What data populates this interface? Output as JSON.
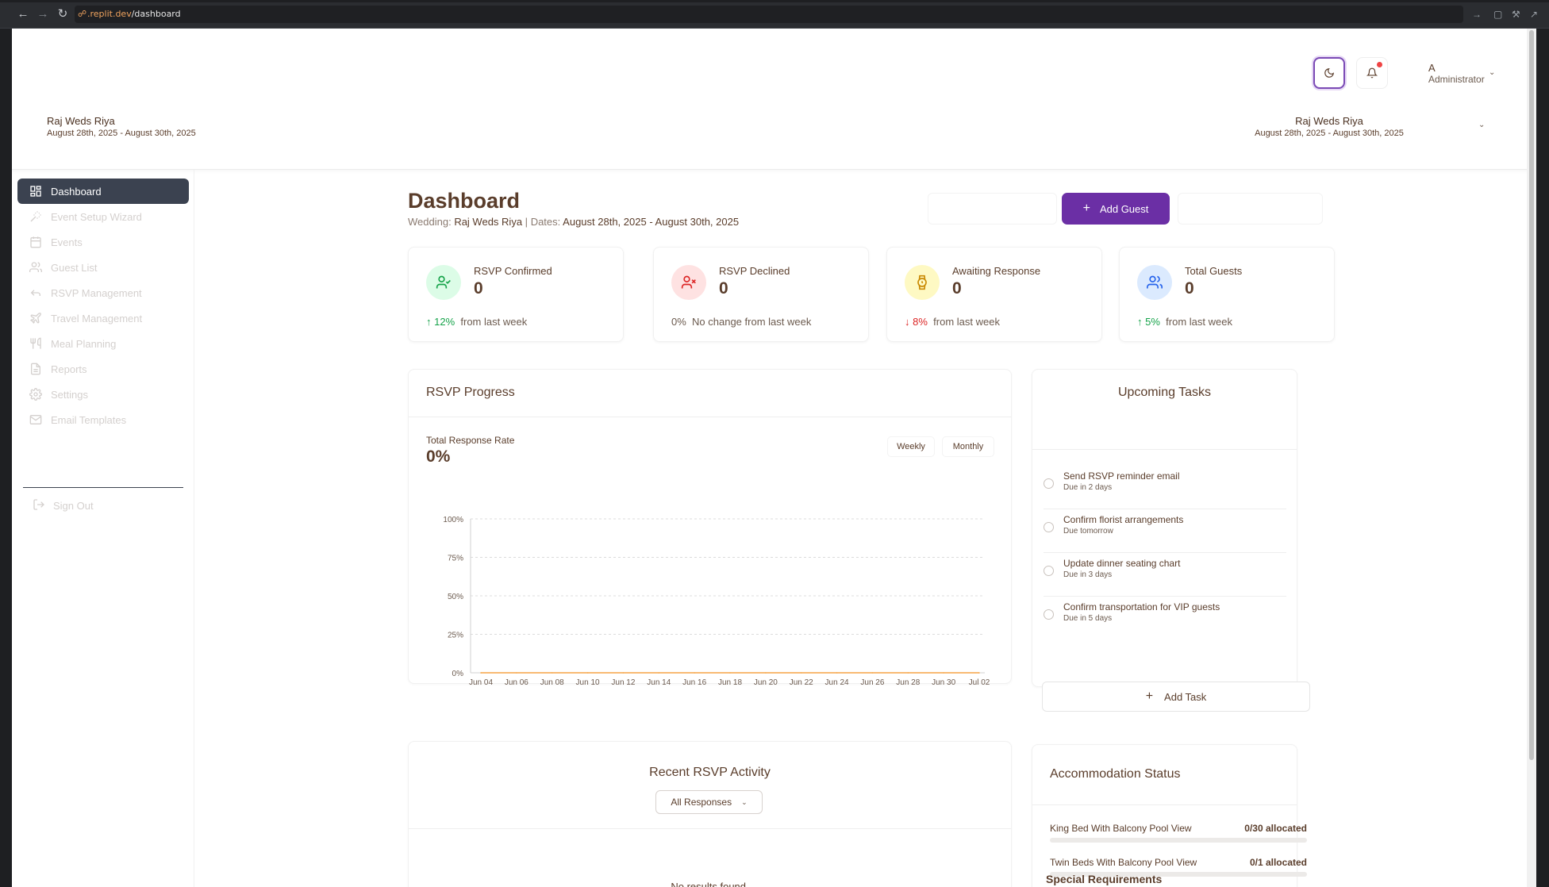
{
  "browser": {
    "url_host": ".replit.dev",
    "url_path": "/dashboard"
  },
  "header": {
    "user_initial": "A",
    "user_role": "Administrator",
    "wedding_title": "Raj Weds Riya",
    "wedding_dates": "August 28th, 2025 - August 30th, 2025",
    "selector_title": "Raj Weds Riya",
    "selector_dates": "August 28th, 2025 - August 30th, 2025"
  },
  "sidebar": {
    "items": [
      {
        "label": "Dashboard",
        "icon": "grid-icon"
      },
      {
        "label": "Event Setup Wizard",
        "icon": "wand-icon"
      },
      {
        "label": "Events",
        "icon": "calendar-icon"
      },
      {
        "label": "Guest List",
        "icon": "users-icon"
      },
      {
        "label": "RSVP Management",
        "icon": "reply-icon"
      },
      {
        "label": "Travel Management",
        "icon": "plane-icon"
      },
      {
        "label": "Meal Planning",
        "icon": "utensils-icon"
      },
      {
        "label": "Reports",
        "icon": "file-icon"
      },
      {
        "label": "Settings",
        "icon": "gear-icon"
      },
      {
        "label": "Email Templates",
        "icon": "mail-icon"
      }
    ],
    "sign_out": "Sign Out"
  },
  "main": {
    "title": "Dashboard",
    "subtitle_wedding_label": "Wedding:",
    "subtitle_wedding": "Raj Weds Riya",
    "subtitle_sep": "|",
    "subtitle_dates_label": "Dates:",
    "subtitle_dates": "August 28th, 2025 - August 30th, 2025",
    "add_guest": "Add Guest"
  },
  "stats": [
    {
      "label": "RSVP Confirmed",
      "value": "0",
      "change": "12%",
      "direction": "up",
      "note": "from last week",
      "color": "#16a34a",
      "bg": "#dcfce7",
      "icon": "user-check-icon"
    },
    {
      "label": "RSVP Declined",
      "value": "0",
      "change": "0%",
      "direction": "none",
      "note": "No change from last week",
      "color": "#dc2626",
      "bg": "#fee2e2",
      "icon": "user-x-icon"
    },
    {
      "label": "Awaiting Response",
      "value": "0",
      "change": "8%",
      "direction": "down",
      "note": "from last week",
      "color": "#ca8a04",
      "bg": "#fef9c3",
      "icon": "watch-icon"
    },
    {
      "label": "Total Guests",
      "value": "0",
      "change": "5%",
      "direction": "up",
      "note": "from last week",
      "color": "#2563eb",
      "bg": "#dbeafe",
      "icon": "users-icon"
    }
  ],
  "progress": {
    "title": "RSVP Progress",
    "rate_label": "Total Response Rate",
    "rate_value": "0%",
    "weekly": "Weekly",
    "monthly": "Monthly"
  },
  "chart_data": {
    "type": "line",
    "categories": [
      "Jun 04",
      "Jun 06",
      "Jun 08",
      "Jun 10",
      "Jun 12",
      "Jun 14",
      "Jun 16",
      "Jun 18",
      "Jun 20",
      "Jun 22",
      "Jun 24",
      "Jun 26",
      "Jun 28",
      "Jun 30",
      "Jul 02"
    ],
    "series": [
      {
        "values": [
          0,
          0,
          0,
          0,
          0,
          0,
          0,
          0,
          0,
          0,
          0,
          0,
          0,
          0,
          0
        ],
        "color": "#f5a445"
      }
    ],
    "yticks": [
      "0%",
      "25%",
      "50%",
      "75%",
      "100%"
    ],
    "ylim": [
      0,
      100
    ],
    "grid": true
  },
  "tasks": {
    "title": "Upcoming Tasks",
    "items": [
      {
        "title": "Send RSVP reminder email",
        "due": "Due in 2 days"
      },
      {
        "title": "Confirm florist arrangements",
        "due": "Due tomorrow"
      },
      {
        "title": "Update dinner seating chart",
        "due": "Due in 3 days"
      },
      {
        "title": "Confirm transportation for VIP guests",
        "due": "Due in 5 days"
      }
    ],
    "add_task": "Add Task"
  },
  "activity": {
    "title": "Recent RSVP Activity",
    "filter": "All Responses",
    "empty": "No results found."
  },
  "accommodation": {
    "title": "Accommodation Status",
    "rooms": [
      {
        "name": "King Bed With Balcony Pool View",
        "allocated": "0/30 allocated",
        "fraction": 0
      },
      {
        "name": "Twin Beds With Balcony Pool View",
        "allocated": "0/1 allocated",
        "fraction": 0
      }
    ],
    "special_title": "Special Requirements"
  },
  "colors": {
    "primary": "#6b2fa5",
    "sidebar_active": "#3b4250",
    "text": "#5a3d2b"
  }
}
